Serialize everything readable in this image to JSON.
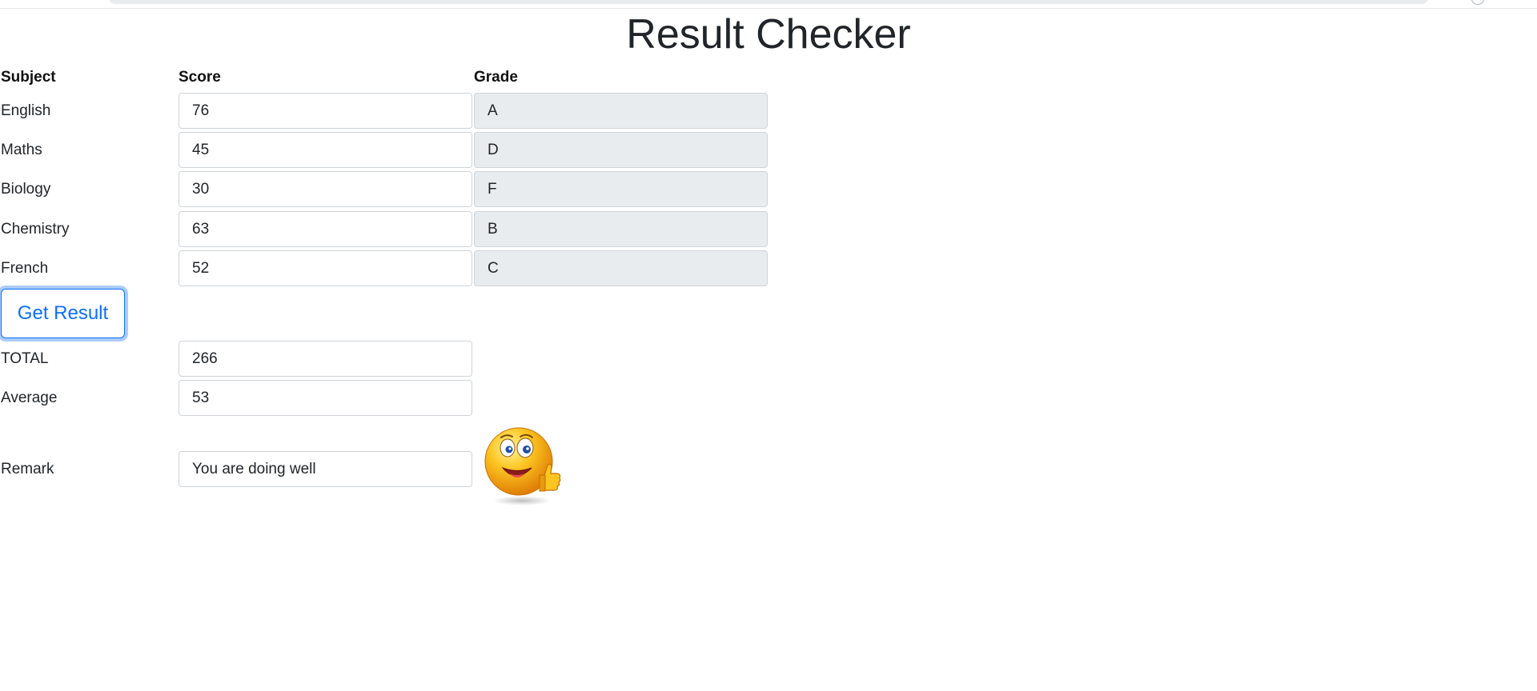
{
  "page": {
    "title": "Result Checker"
  },
  "columns": {
    "subject": "Subject",
    "score": "Score",
    "grade": "Grade"
  },
  "subjects": [
    {
      "name": "English",
      "score": "76",
      "grade": "A"
    },
    {
      "name": "Maths",
      "score": "45",
      "grade": "D"
    },
    {
      "name": "Biology",
      "score": "30",
      "grade": "F"
    },
    {
      "name": "Chemistry",
      "score": "63",
      "grade": "B"
    },
    {
      "name": "French",
      "score": "52",
      "grade": "C"
    }
  ],
  "button": {
    "label": "Get Result"
  },
  "results": {
    "total_label": "TOTAL",
    "total_value": "266",
    "average_label": "Average",
    "average_value": "53",
    "remark_label": "Remark",
    "remark_value": "You are doing well"
  },
  "icons": {
    "remark_emoji": "thumbs-up-smiley-icon"
  },
  "colors": {
    "accent": "#0d6efd",
    "readonly_bg": "#e9ecef",
    "border": "#ced4da"
  }
}
